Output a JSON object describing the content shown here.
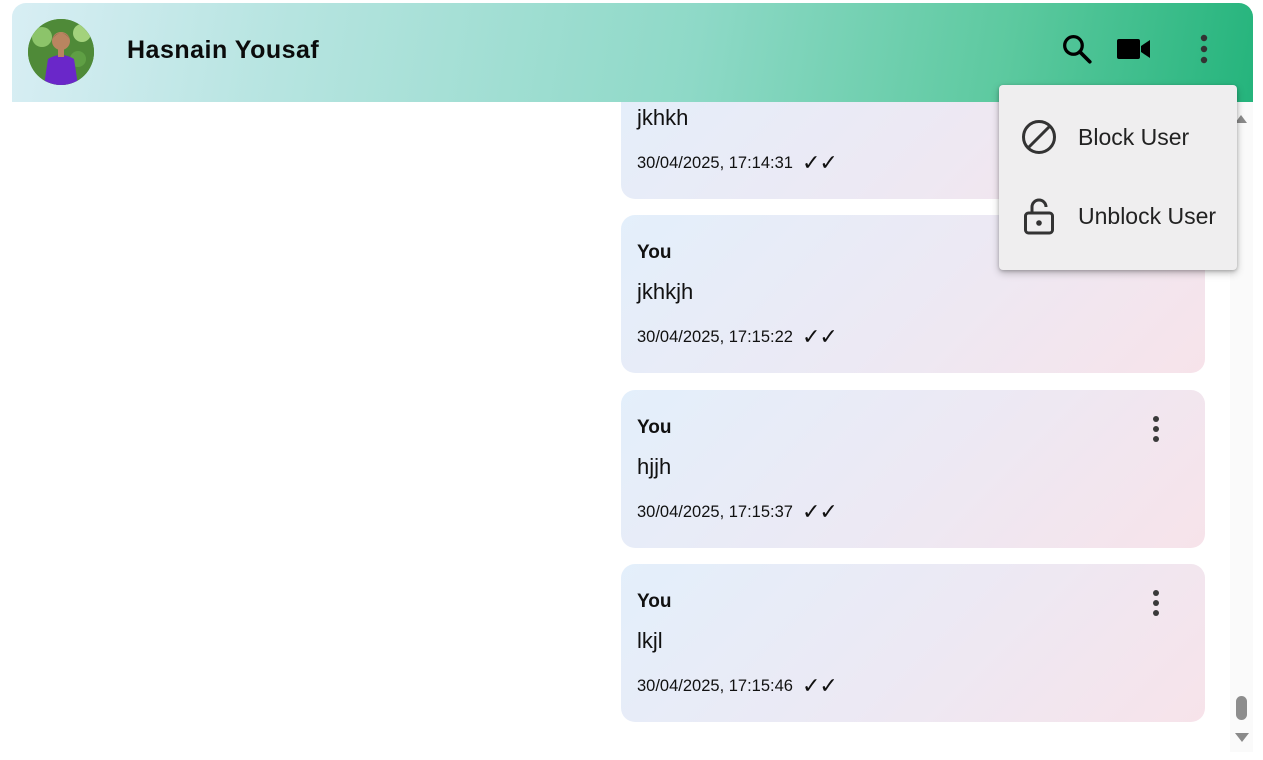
{
  "header": {
    "contact_name": "Hasnain Yousaf",
    "icons": [
      "search-icon",
      "video-call-icon",
      "more-vert-icon"
    ],
    "accent_start": "#d8eef4",
    "accent_end": "#25b47c"
  },
  "menu": {
    "items": [
      {
        "label": "Block User",
        "icon": "block-icon"
      },
      {
        "label": "Unblock User",
        "icon": "unlock-icon"
      }
    ]
  },
  "messages": [
    {
      "sender": "",
      "text": "jkhkh",
      "time": "30/04/2025, 17:14:31",
      "ticks": "✓✓"
    },
    {
      "sender": "You",
      "text": "jkhkjh",
      "time": "30/04/2025, 17:15:22",
      "ticks": "✓✓"
    },
    {
      "sender": "You",
      "text": "hjjh",
      "time": "30/04/2025, 17:15:37",
      "ticks": "✓✓"
    },
    {
      "sender": "You",
      "text": "lkjl",
      "time": "30/04/2025, 17:15:46",
      "ticks": "✓✓"
    }
  ]
}
